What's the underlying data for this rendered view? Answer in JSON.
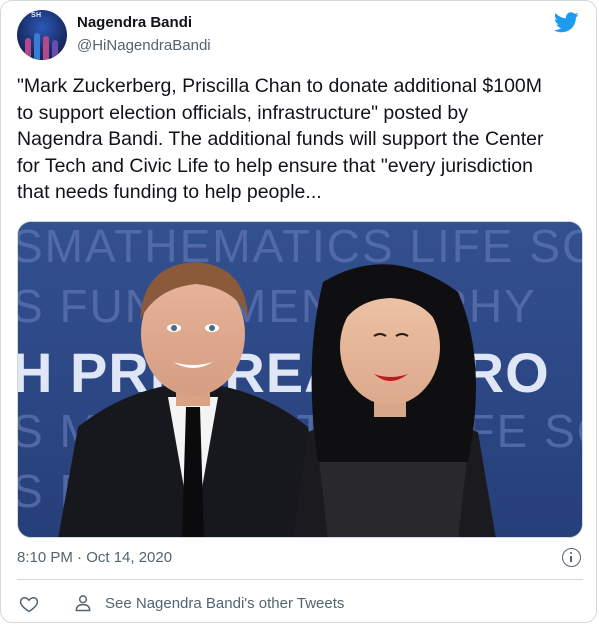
{
  "author": {
    "display_name": "Nagendra Bandi",
    "handle": "@HiNagendraBandi",
    "avatar_icon": "avatar-photo"
  },
  "brand_icon": "twitter-bird-icon",
  "brand_color": "#1d9bf0",
  "tweet": {
    "text": "\"Mark Zuckerberg, Priscilla Chan to donate additional $100M\nto support election officials, infrastructure\" posted by\nNagendra Bandi. The additional funds will support the Center\nfor Tech and Civic Life to help ensure that \"every jurisdiction\nthat needs funding to help people..."
  },
  "media": {
    "backdrop_words": [
      "SMATHEMATICS LIFE SCIE",
      "S FUNDAMENTAL PHY",
      "H PRI BREAKTHRO",
      "S MATHEMATICS LIFE SCIE",
      "S FUN P"
    ],
    "backdrop_color": "#2b4687"
  },
  "meta": {
    "timestamp": "8:10 PM · Oct 14, 2020",
    "info_icon": "info-icon"
  },
  "actions": {
    "like_icon": "heart-icon",
    "profile_icon": "person-icon",
    "other_tweets_label": "See Nagendra Bandi's other Tweets"
  }
}
